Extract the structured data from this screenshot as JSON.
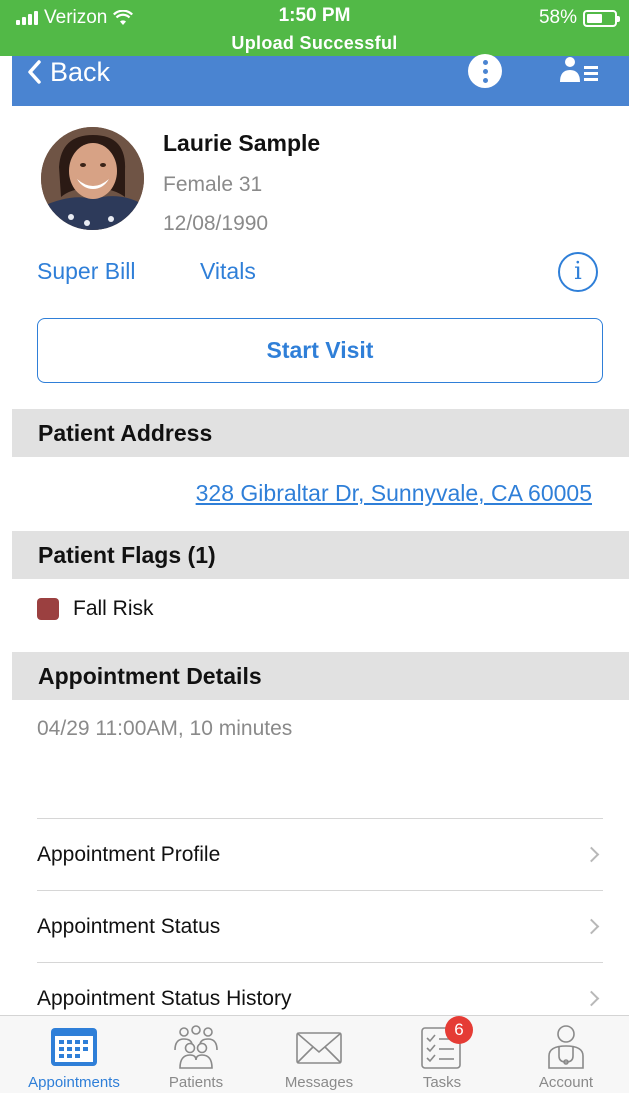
{
  "status_bar": {
    "carrier": "Verizon",
    "time": "1:50 PM",
    "banner": "Upload Successful",
    "battery": "58%",
    "battery_level": 0.58
  },
  "nav": {
    "back_label": "Back"
  },
  "patient": {
    "name": "Laurie Sample",
    "gender_age": "Female 31",
    "dob": "12/08/1990"
  },
  "links": {
    "super_bill": "Super Bill",
    "vitals": "Vitals"
  },
  "actions": {
    "start_visit": "Start Visit"
  },
  "address_section": {
    "title": "Patient Address",
    "address": "328 Gibraltar Dr, Sunnyvale, CA 60005"
  },
  "flags_section": {
    "title": "Patient Flags (1)",
    "items": [
      {
        "label": "Fall Risk",
        "color": "#9b4040"
      }
    ]
  },
  "appointment_section": {
    "title": "Appointment Details",
    "time": "04/29 11:00AM, 10 minutes"
  },
  "menu": {
    "items": [
      {
        "label": "Appointment Profile"
      },
      {
        "label": "Appointment Status"
      },
      {
        "label": "Appointment Status History"
      }
    ]
  },
  "tabs": [
    {
      "label": "Appointments",
      "icon": "calendar-icon",
      "active": true
    },
    {
      "label": "Patients",
      "icon": "people-icon"
    },
    {
      "label": "Messages",
      "icon": "envelope-icon"
    },
    {
      "label": "Tasks",
      "icon": "checklist-icon",
      "badge": "6"
    },
    {
      "label": "Account",
      "icon": "doctor-icon"
    }
  ],
  "colors": {
    "status_green": "#52b947",
    "nav_blue": "#4a84d1",
    "link_blue": "#2f7fd8",
    "badge_red": "#e53c35"
  }
}
